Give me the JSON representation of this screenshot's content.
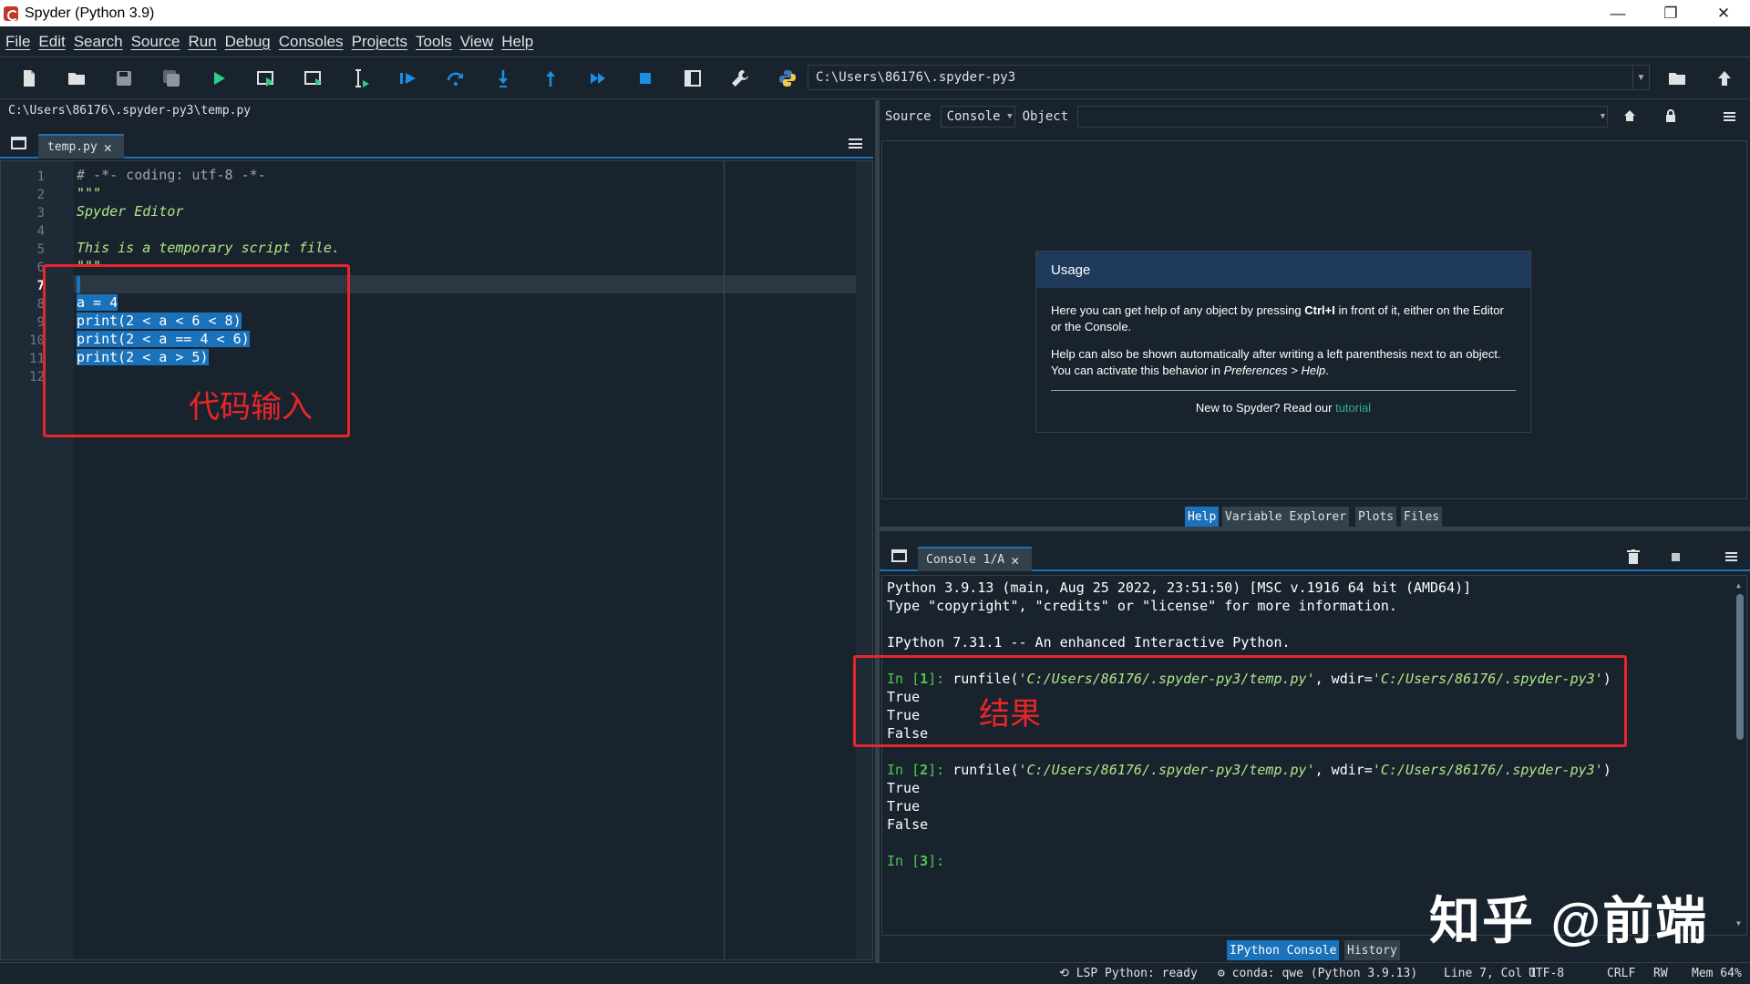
{
  "window": {
    "title": "Spyder (Python 3.9)",
    "minimize": "—",
    "restore": "❐",
    "close": "✕"
  },
  "menu": [
    "File",
    "Edit",
    "Search",
    "Source",
    "Run",
    "Debug",
    "Consoles",
    "Projects",
    "Tools",
    "View",
    "Help"
  ],
  "toolbar": {
    "icons": [
      "new-file-icon",
      "open-file-icon",
      "save-icon",
      "save-all-icon",
      "run-icon",
      "run-cell-icon",
      "run-cell-advance-icon",
      "run-selection-icon",
      "debug-icon",
      "step-over-icon",
      "step-into-icon",
      "step-return-icon",
      "continue-icon",
      "stop-debug-icon",
      "maximize-pane-icon",
      "preferences-wrench-icon",
      "python-path-icon"
    ],
    "working_dir": "C:\\Users\\86176\\.spyder-py3"
  },
  "editor": {
    "file_path": "C:\\Users\\86176\\.spyder-py3\\temp.py",
    "tab_label": "temp.py",
    "close_glyph": "✕",
    "current_line": 7,
    "line_numbers": [
      "1",
      "2",
      "3",
      "4",
      "5",
      "6",
      "7",
      "8",
      "9",
      "10",
      "11",
      "12"
    ],
    "lines": [
      "# -*- coding: utf-8 -*-",
      "\"\"\"",
      "Spyder Editor",
      "",
      "This is a temporary script file.",
      "\"\"\"",
      "",
      "a = 4",
      "print(2 < a < 6 < 8)",
      "print(2 < a == 4 < 6)",
      "print(2 < a > 5)",
      ""
    ],
    "annotation": "代码输入"
  },
  "help": {
    "source_label": "Source",
    "source_value": "Console",
    "object_label": "Object",
    "object_value": "",
    "usage_title": "Usage",
    "usage_p1_a": "Here you can get help of any object by pressing ",
    "usage_p1_key": "Ctrl+I",
    "usage_p1_b": " in front of it, either on the Editor or the Console.",
    "usage_p2_a": "Help can also be shown automatically after writing a left parenthesis next to an object. You can activate this behavior in ",
    "usage_p2_em": "Preferences > Help",
    "usage_p2_b": ".",
    "usage_foot": "New to Spyder? Read our ",
    "usage_link": "tutorial",
    "bottom_tabs": [
      "Help",
      "Variable Explorer",
      "Plots",
      "Files"
    ],
    "active_tab": "Help"
  },
  "console": {
    "tab_label": "Console 1/A",
    "close_glyph": "✕",
    "banner1": "Python 3.9.13 (main, Aug 25 2022, 23:51:50) [MSC v.1916 64 bit (AMD64)]",
    "banner2": "Type \"copyright\", \"credits\" or \"license\" for more information.",
    "banner3": "IPython 7.31.1 -- An enhanced Interactive Python.",
    "in1_prefix": "In [",
    "in1_num": "1",
    "in_suffix": "]: ",
    "cmd_a": "runfile(",
    "cmd_path": "'C:/Users/86176/.spyder-py3/temp.py'",
    "cmd_mid": ", wdir=",
    "cmd_wdir": "'C:/Users/86176/.spyder-py3'",
    "cmd_end": ")",
    "out1": [
      "True",
      "True",
      "False"
    ],
    "in2_num": "2",
    "out2": [
      "True",
      "True",
      "False"
    ],
    "in3_num": "3",
    "annotation": "结果",
    "bottom_tabs": [
      "IPython Console",
      "History"
    ],
    "active_tab": "IPython Console"
  },
  "watermark": "知乎 @前端",
  "status": {
    "lsp": "LSP Python: ready",
    "conda": "conda: qwe (Python 3.9.13)",
    "position": "Line 7, Col 1",
    "encoding": "UTF-8",
    "eol": "CRLF",
    "rw": "RW",
    "mem": "Mem 64%"
  },
  "colors": {
    "background": "#19232d",
    "accent": "#1a72bb",
    "annotation": "#e8262a",
    "prompt": "#4ec94e",
    "string": "#b0e686"
  }
}
